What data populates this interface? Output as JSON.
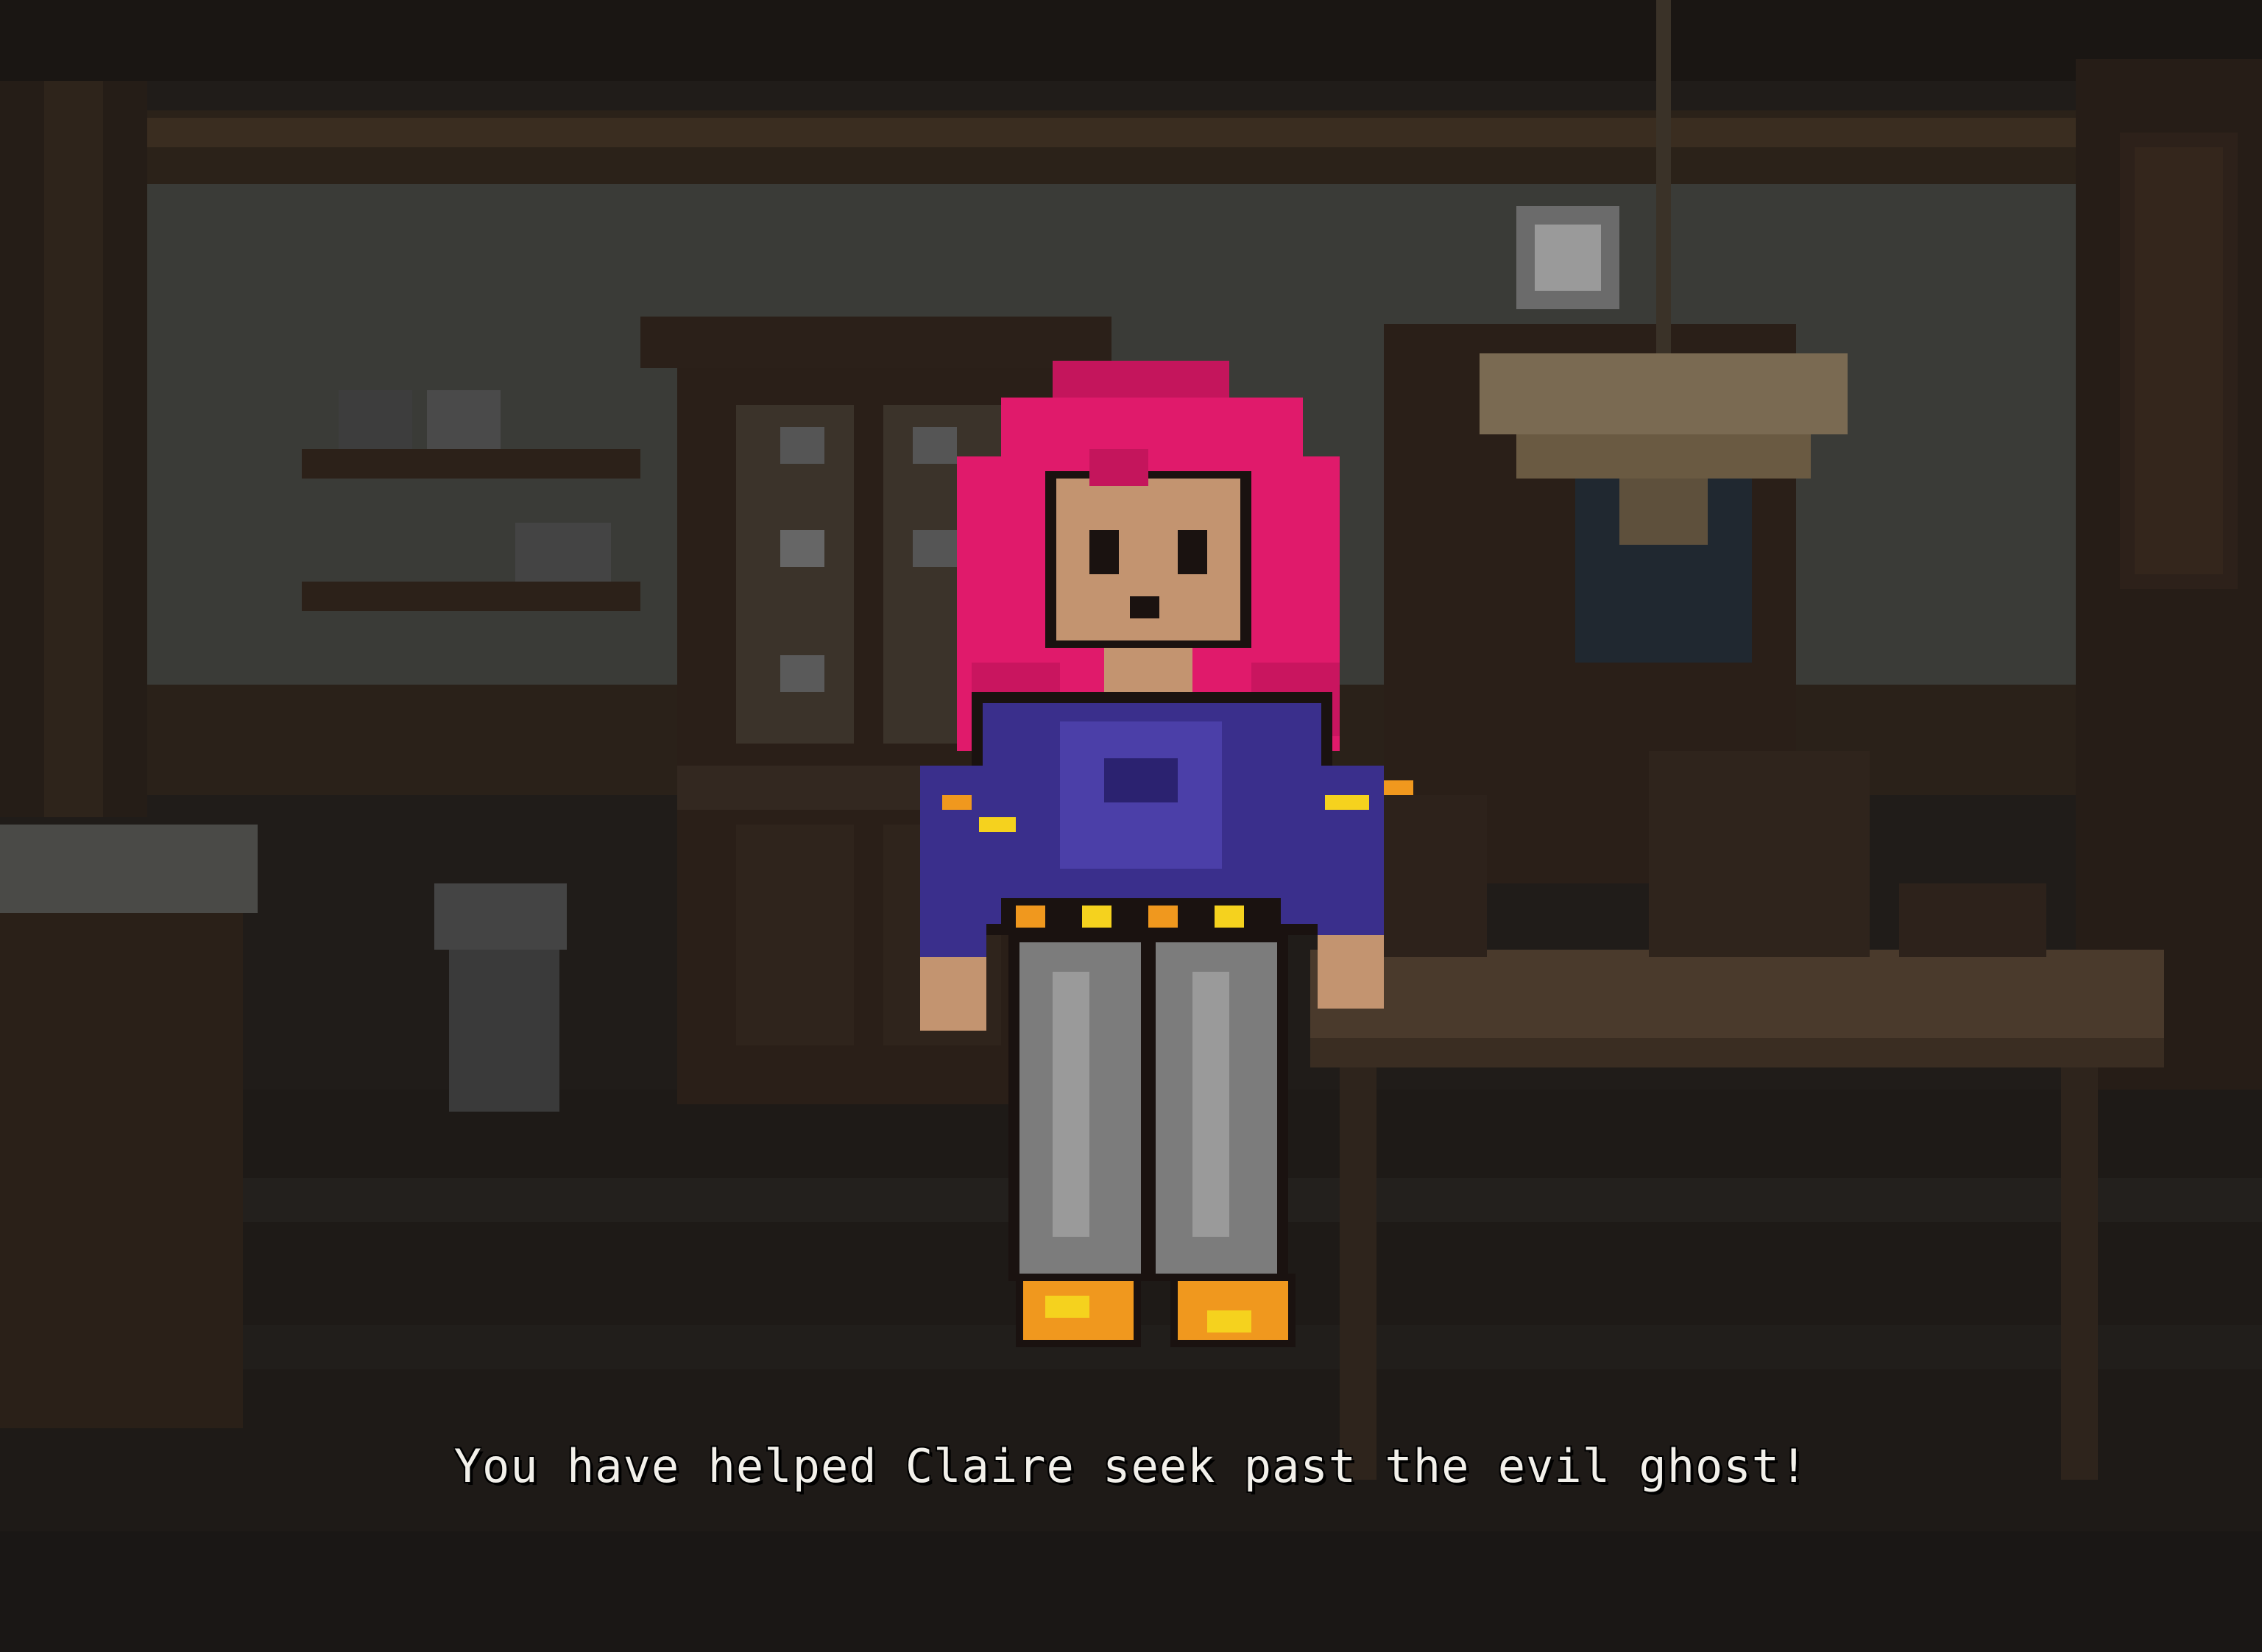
{
  "game": {
    "caption": "You have helped Claire seek past the evil ghost!"
  },
  "colors": {
    "background": "#1c1917",
    "hair": "#e01a6b",
    "sweater": "#3a2f8c",
    "pants": "#7c7c7c",
    "shoes": "#f0981e",
    "skin": "#c39470",
    "caption_text": "#f2f0ea"
  },
  "icons": {
    "character": "claire-sprite",
    "decor": [
      "wall-clock",
      "chandelier",
      "china-cabinet",
      "wall-shelves",
      "dining-table",
      "chairs",
      "side-table",
      "urn"
    ]
  }
}
